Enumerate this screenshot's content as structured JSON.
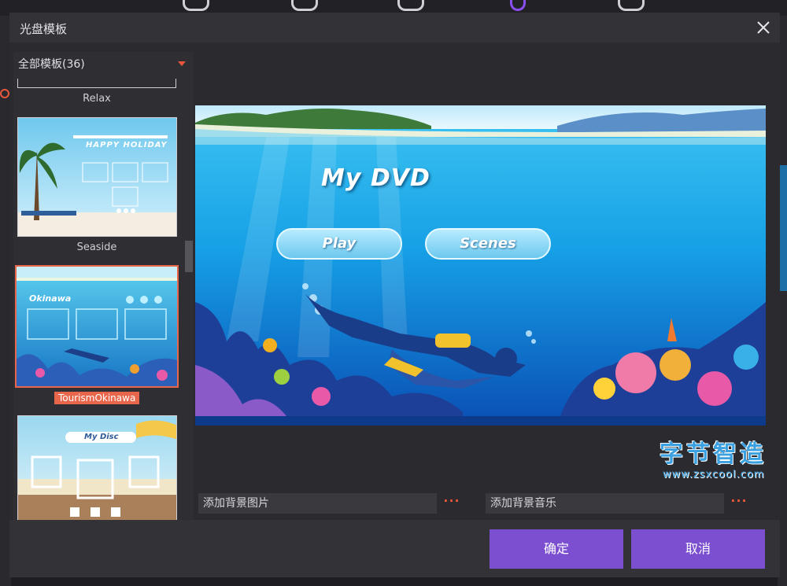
{
  "dialog": {
    "title": "光盘模板",
    "close_icon": "close-icon"
  },
  "templates": {
    "filter_label": "全部模板(36)",
    "items": [
      {
        "name": "Relax"
      },
      {
        "name": "Seaside",
        "thumb_text": "HAPPY HOLIDAY"
      },
      {
        "name": "TourismOkinawa",
        "thumb_text": "Okinawa",
        "selected": true
      },
      {
        "name": "",
        "thumb_text": "My Disc"
      }
    ]
  },
  "preview": {
    "title": "My DVD",
    "buttons": [
      "Play",
      "Scenes"
    ]
  },
  "watermark": {
    "text": "字节智造",
    "url": "www.zsxcool.com"
  },
  "fields": {
    "bg_image": "添加背景图片",
    "bg_music": "添加背景音乐",
    "more": "···"
  },
  "footer": {
    "ok": "确定",
    "cancel": "取消"
  },
  "colors": {
    "accent": "#7b4fd0",
    "highlight": "#e8674c",
    "panel": "#2b2b2f"
  }
}
